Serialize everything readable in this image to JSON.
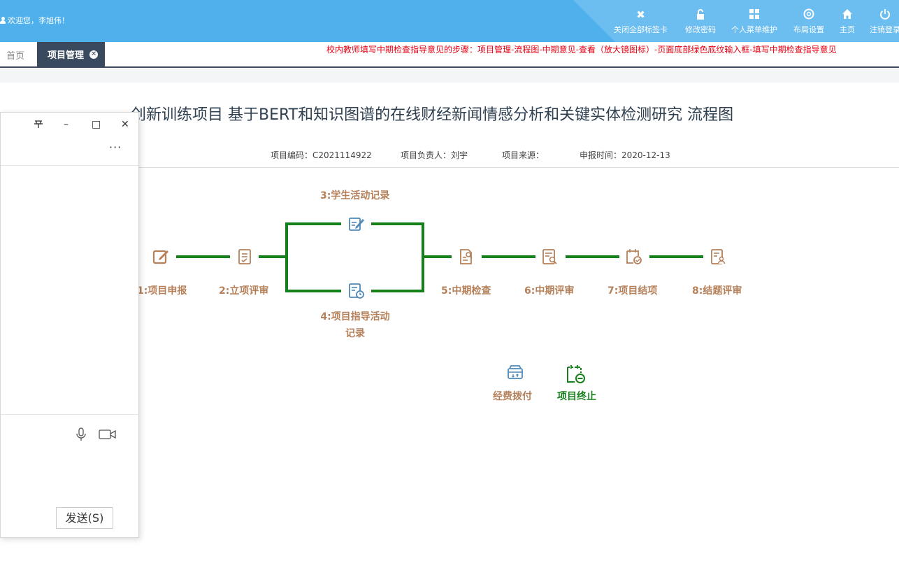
{
  "header": {
    "welcome": "欢迎您，李旭伟！",
    "tools": [
      {
        "icon": "close-icon",
        "label": "关闭全部标签卡"
      },
      {
        "icon": "lock-icon",
        "label": "修改密码"
      },
      {
        "icon": "grid-icon",
        "label": "个人菜单维护"
      },
      {
        "icon": "lifebuoy-icon",
        "label": "布局设置"
      },
      {
        "icon": "home-icon",
        "label": "主页"
      },
      {
        "icon": "power-icon",
        "label": "注销登录"
      }
    ]
  },
  "tabs": {
    "home": "首页",
    "active": "项目管理"
  },
  "notice": "校内教师填写中期检查指导意见的步骤：项目管理-流程图-中期意见-查看（放大镜图标）-页面底部绿色底纹输入框-填写中期检查指导意见",
  "main": {
    "title": "创新训练项目  基于BERT和知识图谱的在线财经新闻情感分析和关键实体检测研究 流程图",
    "meta": {
      "code": "项目编码：C2021114922",
      "leader": "项目负责人：刘宇",
      "source": "项目来源：",
      "date": "申报时间：2020-12-13"
    }
  },
  "flow": {
    "steps": [
      {
        "label": "1:项目申报",
        "icon": "edit-icon"
      },
      {
        "label": "2:立项评审",
        "icon": "checklist-icon"
      },
      {
        "label": "3:学生活动记录",
        "icon": "note-edit-icon"
      },
      {
        "label": "4:项目指导活动记录",
        "icon": "record-clock-icon"
      },
      {
        "label": "5:中期检查",
        "icon": "doc-search-icon"
      },
      {
        "label": "6:中期评审",
        "icon": "doc-review-icon"
      },
      {
        "label": "7:项目结项",
        "icon": "calendar-check-icon"
      },
      {
        "label": "8:结题评审",
        "icon": "doc-user-icon"
      }
    ],
    "extra": [
      {
        "label": "经费拨付",
        "icon": "cashbox-icon"
      },
      {
        "label": "项目终止",
        "icon": "calendar-stop-icon"
      }
    ],
    "colors": {
      "line": "#16801c",
      "label": "#b5815a",
      "icon": "#b5815a",
      "blue_icon": "#4f89b8",
      "green_label": "#16801c"
    }
  },
  "chat": {
    "pin": "pin-icon",
    "minimize": "–",
    "maximize": "□",
    "close": "✕",
    "more": "···",
    "send": "发送(S)"
  }
}
